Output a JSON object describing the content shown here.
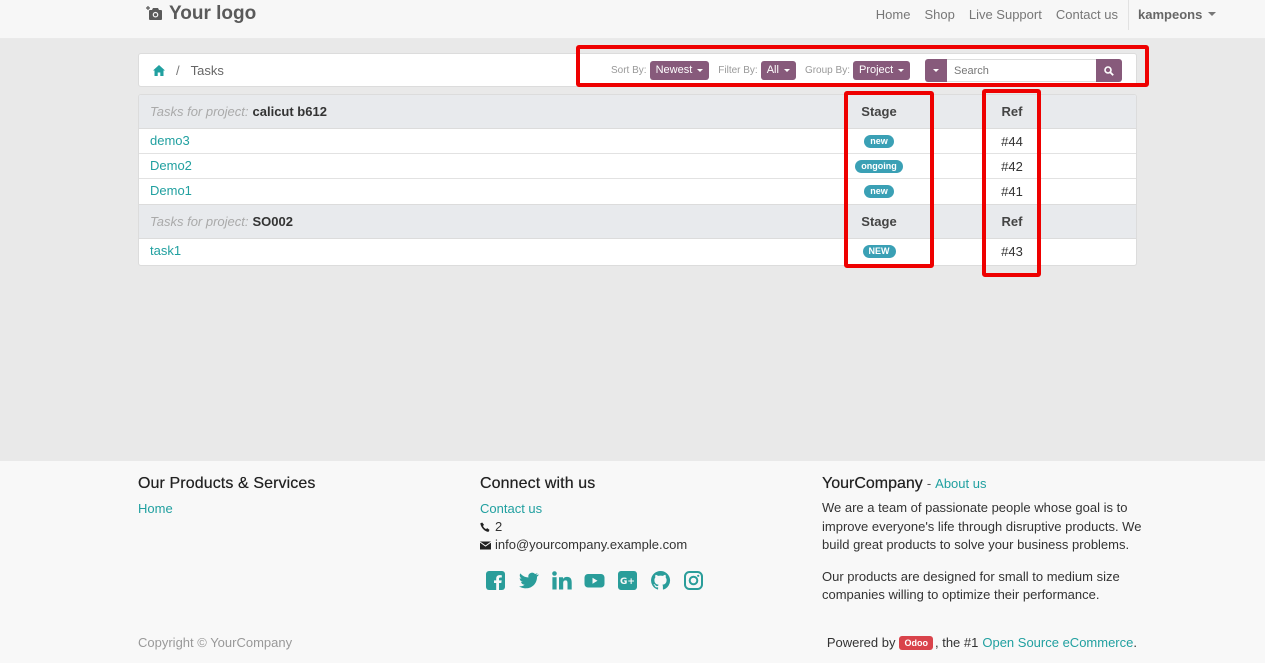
{
  "header": {
    "logo_text": "Your logo",
    "nav": [
      "Home",
      "Shop",
      "Live Support",
      "Contact us"
    ],
    "user": "kampeons"
  },
  "breadcrumb": {
    "current": "Tasks",
    "separator": "/"
  },
  "filters": {
    "sort_label": "Sort By:",
    "sort_value": "Newest",
    "filter_label": "Filter By:",
    "filter_value": "All",
    "group_label": "Group By:",
    "group_value": "Project",
    "search_placeholder": "Search"
  },
  "table": {
    "group_prefix": "Tasks for project:",
    "stage_header": "Stage",
    "ref_header": "Ref",
    "groups": [
      {
        "project": "calicut b612",
        "tasks": [
          {
            "name": "demo3",
            "stage": "new",
            "ref": "#44"
          },
          {
            "name": "Demo2",
            "stage": "ongoing",
            "ref": "#42"
          },
          {
            "name": "Demo1",
            "stage": "new",
            "ref": "#41"
          }
        ]
      },
      {
        "project": "SO002",
        "tasks": [
          {
            "name": "task1",
            "stage": "NEW",
            "ref": "#43"
          }
        ]
      }
    ]
  },
  "footer": {
    "products_title": "Our Products & Services",
    "products_links": [
      "Home"
    ],
    "connect_title": "Connect with us",
    "contact_link": "Contact us",
    "phone": "2",
    "email": "info@yourcompany.example.com",
    "social_icons": [
      "facebook-icon",
      "twitter-icon",
      "linkedin-icon",
      "youtube-icon",
      "google-plus-icon",
      "github-icon",
      "instagram-icon"
    ],
    "company_name": "YourCompany",
    "company_dash": "-",
    "about_link": "About us",
    "about_p1": "We are a team of passionate people whose goal is to improve everyone's life through disruptive products. We build great products to solve your business problems.",
    "about_p2": "Our products are designed for small to medium size companies willing to optimize their performance.",
    "copyright": "Copyright © YourCompany",
    "powered_by": "Powered by",
    "odoo_badge": "Odoo",
    "powered_mid": ", the #1",
    "powered_link": "Open Source eCommerce",
    "powered_end": "."
  },
  "colors": {
    "accent": "#875a7b",
    "link": "#21a0a0",
    "badge": "#3aa0b5",
    "highlight": "#ee0000",
    "odoo": "#d9434b"
  }
}
